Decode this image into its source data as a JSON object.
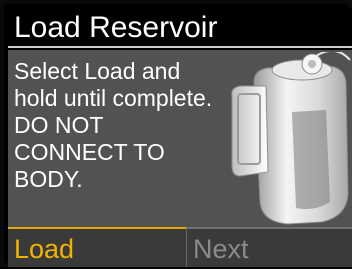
{
  "header": {
    "title": "Load Reservoir"
  },
  "instructions": {
    "lines": [
      "Select Load and",
      "hold until complete.",
      "DO NOT",
      "CONNECT TO",
      "BODY."
    ]
  },
  "softkeys": {
    "left_label": "Load",
    "right_label": "Next"
  },
  "colors": {
    "accent": "#f0b400",
    "background": "#525252",
    "title_bg": "#000000",
    "disabled_text": "#8a8a8a"
  },
  "icons": {
    "device": "insulin-pump-reservoir-icon"
  }
}
